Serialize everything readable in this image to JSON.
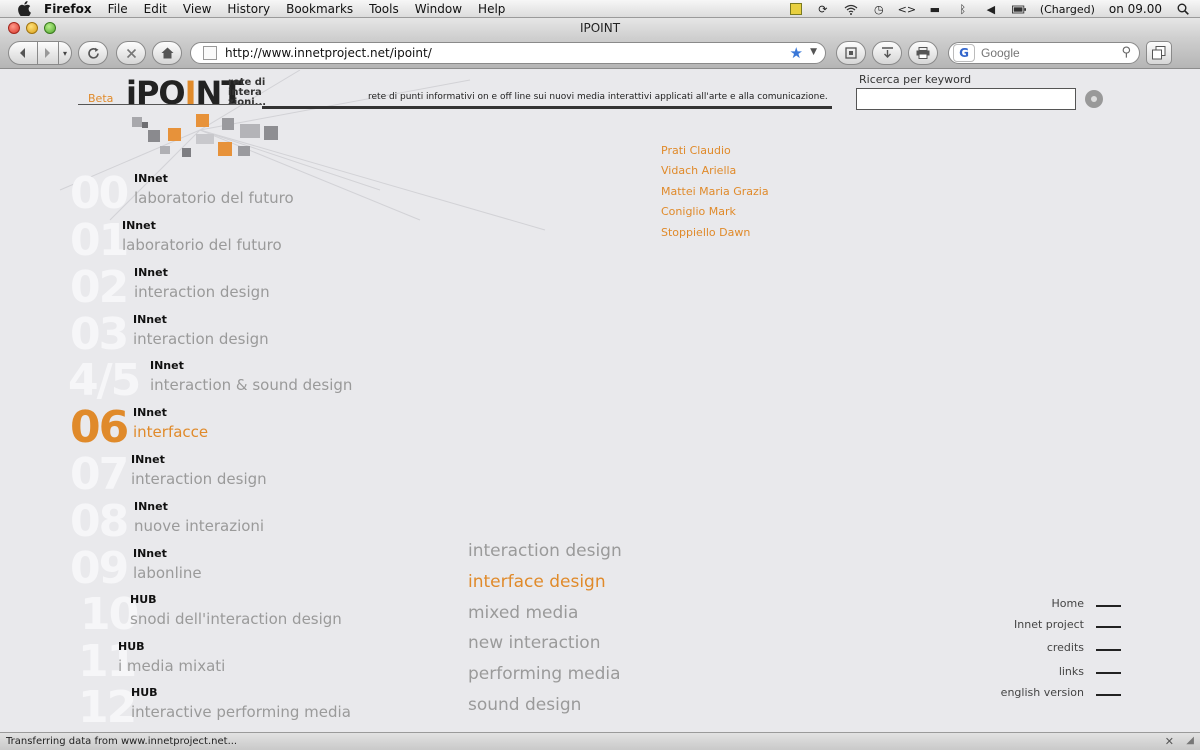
{
  "menubar": {
    "app_name": "Firefox",
    "items": [
      "File",
      "Edit",
      "View",
      "History",
      "Bookmarks",
      "Tools",
      "Window",
      "Help"
    ],
    "battery_text": "(Charged)",
    "clock": "on 09.00"
  },
  "window": {
    "title": "IPOINT"
  },
  "toolbar": {
    "url": "http://www.innetproject.net/ipoint/",
    "search_placeholder": "Google"
  },
  "header": {
    "beta": "Beta",
    "logo_text_pre": "iPO",
    "logo_text_accent": "I",
    "logo_text_post": "NT",
    "logo_sub": "rete di intera zioni...",
    "tagline": "rete di punti informativi on e off line sui nuovi media interattivi applicati all'arte e alla comunicazione."
  },
  "keyword_search": {
    "label": "Ricerca per keyword",
    "value": ""
  },
  "authors": [
    "Prati Claudio",
    "Vidach Ariella",
    "Mattei Maria Grazia",
    "Coniglio Mark",
    "Stoppiello Dawn"
  ],
  "courses": [
    {
      "num": "00",
      "kind": "INnet",
      "title": "laboratorio del futuro",
      "active": false
    },
    {
      "num": "01",
      "kind": "INnet",
      "title": "laboratorio del futuro",
      "active": false
    },
    {
      "num": "02",
      "kind": "INnet",
      "title": "interaction design",
      "active": false
    },
    {
      "num": "03",
      "kind": "INnet",
      "title": "interaction design",
      "active": false
    },
    {
      "num": "4/5",
      "kind": "INnet",
      "title": "interaction & sound design",
      "active": false
    },
    {
      "num": "06",
      "kind": "INnet",
      "title": "interfacce",
      "active": true
    },
    {
      "num": "07",
      "kind": "INnet",
      "title": "interaction design",
      "active": false
    },
    {
      "num": "08",
      "kind": "INnet",
      "title": "nuove interazioni",
      "active": false
    },
    {
      "num": "09",
      "kind": "INnet",
      "title": "labonline",
      "active": false
    },
    {
      "num": "10",
      "kind": "HUB",
      "title": "snodi dell'interaction design",
      "active": false
    },
    {
      "num": "11",
      "kind": "HUB",
      "title": "i media mixati",
      "active": false
    },
    {
      "num": "12",
      "kind": "HUB",
      "title": "interactive performing media",
      "active": false
    }
  ],
  "categories": [
    {
      "label": "interaction design",
      "active": false
    },
    {
      "label": "interface design",
      "active": true
    },
    {
      "label": "mixed media",
      "active": false
    },
    {
      "label": "new interaction",
      "active": false
    },
    {
      "label": "performing media",
      "active": false
    },
    {
      "label": "sound design",
      "active": false
    }
  ],
  "footer_links": [
    "Home",
    "Innet project",
    "credits",
    "links",
    "english version"
  ],
  "status": {
    "text": "Transferring data from www.innetproject.net..."
  },
  "colors": {
    "accent": "#e08a2a",
    "muted": "#9a9a9a",
    "background": "#e9e9ec"
  }
}
